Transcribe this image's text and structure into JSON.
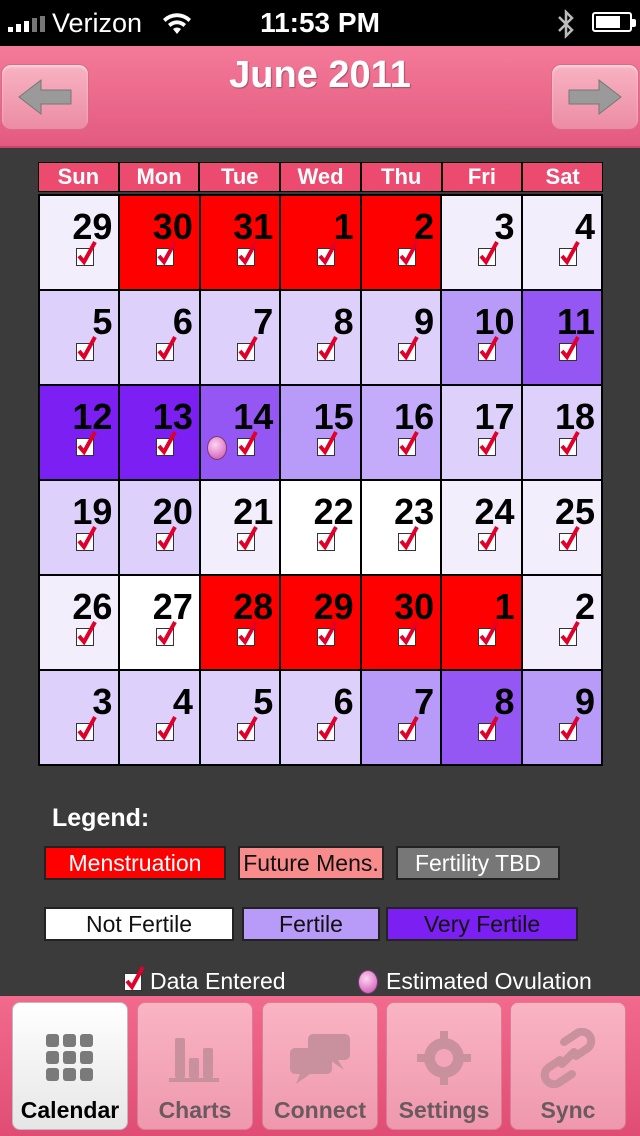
{
  "status_bar": {
    "carrier": "Verizon",
    "time": "11:53 PM"
  },
  "header": {
    "title": "June 2011",
    "prev_icon": "left-arrow-icon",
    "next_icon": "right-arrow-icon"
  },
  "calendar": {
    "days_of_week": [
      "Sun",
      "Mon",
      "Tue",
      "Wed",
      "Thu",
      "Fri",
      "Sat"
    ],
    "colors": {
      "men": "#ff0000",
      "nf": "#ffffff",
      "nf2": "#f3eefc",
      "f1": "#ddd0fb",
      "f2": "#c4acfa",
      "f3": "#b89bf8",
      "vf": "#7b1ff2",
      "vf2": "#9557f4"
    },
    "weeks": [
      [
        {
          "day": "29",
          "status": "nf2",
          "data": true
        },
        {
          "day": "30",
          "status": "men",
          "data": true
        },
        {
          "day": "31",
          "status": "men",
          "data": true
        },
        {
          "day": "1",
          "status": "men",
          "data": true
        },
        {
          "day": "2",
          "status": "men",
          "data": true
        },
        {
          "day": "3",
          "status": "nf2",
          "data": true
        },
        {
          "day": "4",
          "status": "nf2",
          "data": true
        }
      ],
      [
        {
          "day": "5",
          "status": "f1",
          "data": true
        },
        {
          "day": "6",
          "status": "f1",
          "data": true
        },
        {
          "day": "7",
          "status": "f1",
          "data": true
        },
        {
          "day": "8",
          "status": "f1",
          "data": true
        },
        {
          "day": "9",
          "status": "f1",
          "data": true
        },
        {
          "day": "10",
          "status": "f3",
          "data": true
        },
        {
          "day": "11",
          "status": "vf2",
          "data": true
        }
      ],
      [
        {
          "day": "12",
          "status": "vf",
          "data": true
        },
        {
          "day": "13",
          "status": "vf",
          "data": true
        },
        {
          "day": "14",
          "status": "vf2",
          "data": true,
          "ovulation": true
        },
        {
          "day": "15",
          "status": "f3",
          "data": true
        },
        {
          "day": "16",
          "status": "f2",
          "data": true
        },
        {
          "day": "17",
          "status": "f1",
          "data": true
        },
        {
          "day": "18",
          "status": "f1",
          "data": true
        }
      ],
      [
        {
          "day": "19",
          "status": "f1",
          "data": true
        },
        {
          "day": "20",
          "status": "f1",
          "data": true
        },
        {
          "day": "21",
          "status": "nf2",
          "data": true
        },
        {
          "day": "22",
          "status": "nf",
          "data": true
        },
        {
          "day": "23",
          "status": "nf",
          "data": true
        },
        {
          "day": "24",
          "status": "nf2",
          "data": true
        },
        {
          "day": "25",
          "status": "nf2",
          "data": true
        }
      ],
      [
        {
          "day": "26",
          "status": "nf2",
          "data": true
        },
        {
          "day": "27",
          "status": "nf",
          "data": true
        },
        {
          "day": "28",
          "status": "men",
          "data": true
        },
        {
          "day": "29",
          "status": "men",
          "data": true
        },
        {
          "day": "30",
          "status": "men",
          "data": true
        },
        {
          "day": "1",
          "status": "men",
          "data": true
        },
        {
          "day": "2",
          "status": "nf2",
          "data": true
        }
      ],
      [
        {
          "day": "3",
          "status": "f1",
          "data": true
        },
        {
          "day": "4",
          "status": "f1",
          "data": true
        },
        {
          "day": "5",
          "status": "f1",
          "data": true
        },
        {
          "day": "6",
          "status": "f1",
          "data": true
        },
        {
          "day": "7",
          "status": "f3",
          "data": true
        },
        {
          "day": "8",
          "status": "vf2",
          "data": true
        },
        {
          "day": "9",
          "status": "f3",
          "data": true
        }
      ]
    ]
  },
  "legend": {
    "title": "Legend:",
    "menstruation": "Menstruation",
    "future_mens": "Future Mens.",
    "fertility_tbd": "Fertility TBD",
    "not_fertile": "Not Fertile",
    "fertile": "Fertile",
    "very_fertile": "Very Fertile",
    "data_entered": "Data Entered",
    "estimated_ovulation": "Estimated Ovulation"
  },
  "tabbar": {
    "tabs": [
      {
        "label": "Calendar",
        "icon": "grid-icon",
        "active": true
      },
      {
        "label": "Charts",
        "icon": "bar-chart-icon",
        "active": false
      },
      {
        "label": "Connect",
        "icon": "chat-bubbles-icon",
        "active": false
      },
      {
        "label": "Settings",
        "icon": "gear-icon",
        "active": false
      },
      {
        "label": "Sync",
        "icon": "sync-link-icon",
        "active": false
      }
    ]
  }
}
